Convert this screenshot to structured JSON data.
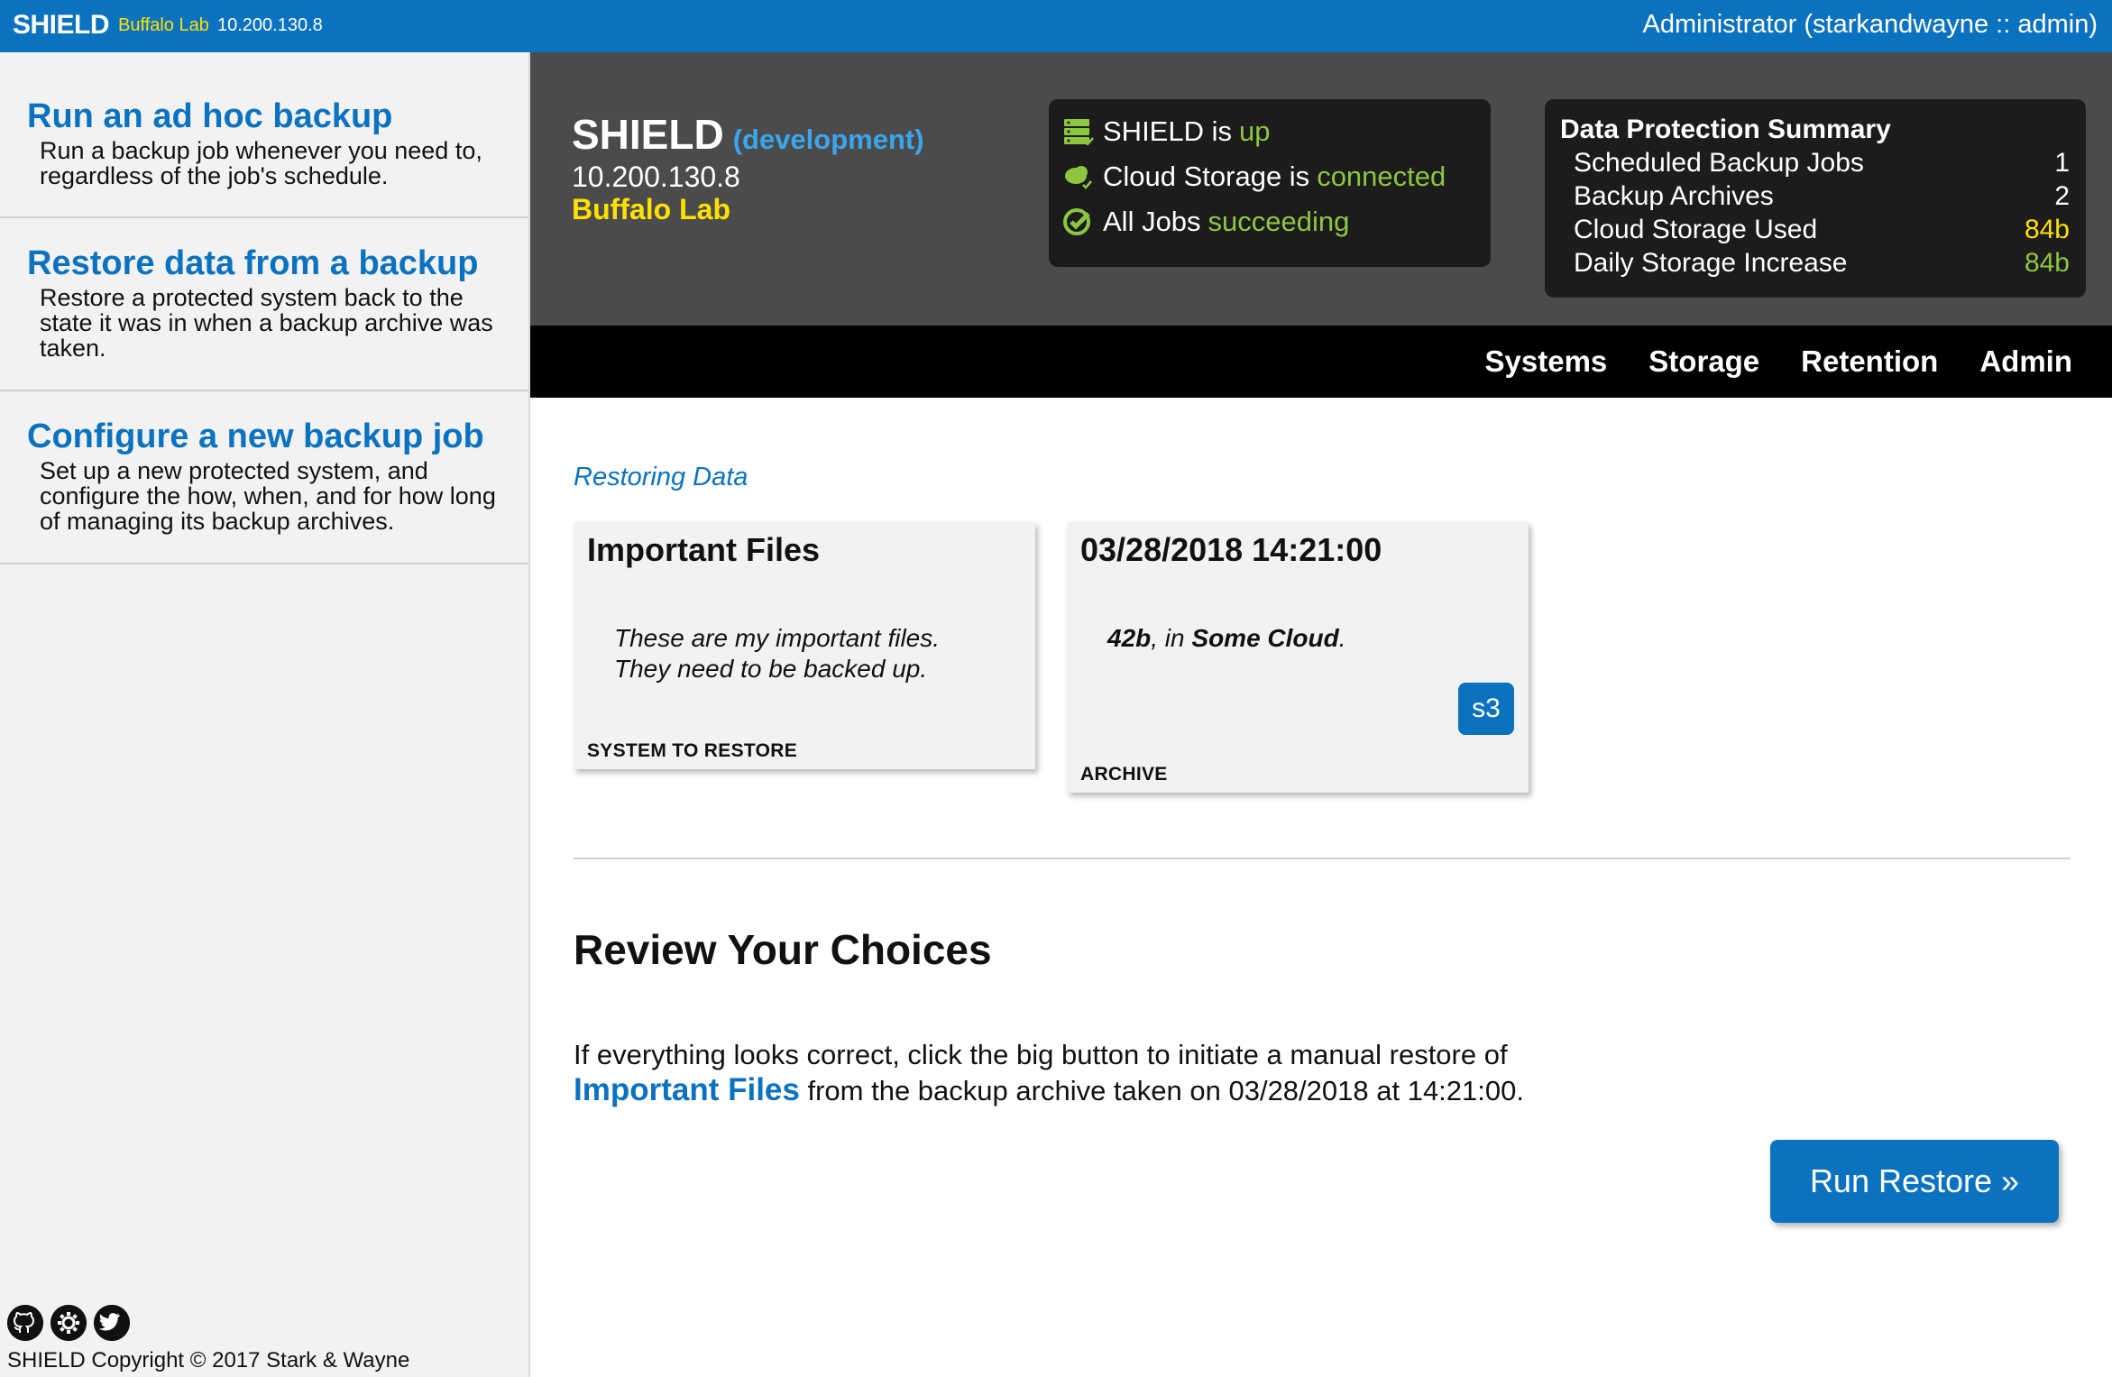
{
  "topbar": {
    "brand": "SHIELD",
    "env": "Buffalo Lab",
    "ip": "10.200.130.8",
    "user": "Administrator (starkandwayne :: admin)"
  },
  "sidebar": {
    "items": [
      {
        "title": "Run an ad hoc backup",
        "desc": "Run a backup job whenever you need to, regardless of the job's schedule."
      },
      {
        "title": "Restore data from a backup",
        "desc": "Restore a protected system back to the state it was in when a backup archive was taken."
      },
      {
        "title": "Configure a new backup job",
        "desc": "Set up a new protected system, and configure the how, when, and for how long of managing its backup archives."
      }
    ],
    "footer_icons": [
      "github-icon",
      "shield-cog-icon",
      "twitter-icon"
    ],
    "copyright": "SHIELD Copyright © 2017 Stark & Wayne"
  },
  "header": {
    "title": "SHIELD",
    "mode": "(development)",
    "ip": "10.200.130.8",
    "site": "Buffalo Lab"
  },
  "status": [
    {
      "icon": "server-icon",
      "label": "SHIELD is",
      "state": "up"
    },
    {
      "icon": "cloud-icon",
      "label": "Cloud Storage is",
      "state": "connected"
    },
    {
      "icon": "check-circle-icon",
      "label": "All Jobs",
      "state": "succeeding"
    }
  ],
  "summary": {
    "title": "Data Protection Summary",
    "rows": [
      {
        "label": "Scheduled Backup Jobs",
        "value": "1",
        "color": "white"
      },
      {
        "label": "Backup Archives",
        "value": "2",
        "color": "white"
      },
      {
        "label": "Cloud Storage Used",
        "value": "84b",
        "color": "yellow"
      },
      {
        "label": "Daily Storage Increase",
        "value": "84b",
        "color": "green"
      }
    ]
  },
  "nav": [
    "Systems",
    "Storage",
    "Retention",
    "Admin"
  ],
  "main": {
    "section_label": "Restoring Data",
    "system_card": {
      "title": "Important Files",
      "line1": "These are my important files.",
      "line2": "They need to be backed up.",
      "footer": "SYSTEM TO RESTORE"
    },
    "archive_card": {
      "title": "03/28/2018 14:21:00",
      "size": "42b",
      "in_text": ", in ",
      "store": "Some Cloud",
      "period": ".",
      "badge": "s3",
      "footer": "ARCHIVE"
    },
    "review_heading": "Review Your Choices",
    "review_pre": "If everything looks correct, click the big button to initiate a manual restore of",
    "review_link": "Important Files",
    "review_post": " from the backup archive taken on 03/28/2018 at 14:21:00.",
    "button": "Run Restore »"
  },
  "colors": {
    "brand_blue": "#0b72c0",
    "accent_yellow": "#ffe100",
    "ok_green": "#8dc63f",
    "header_gray": "#4b4b4b"
  }
}
